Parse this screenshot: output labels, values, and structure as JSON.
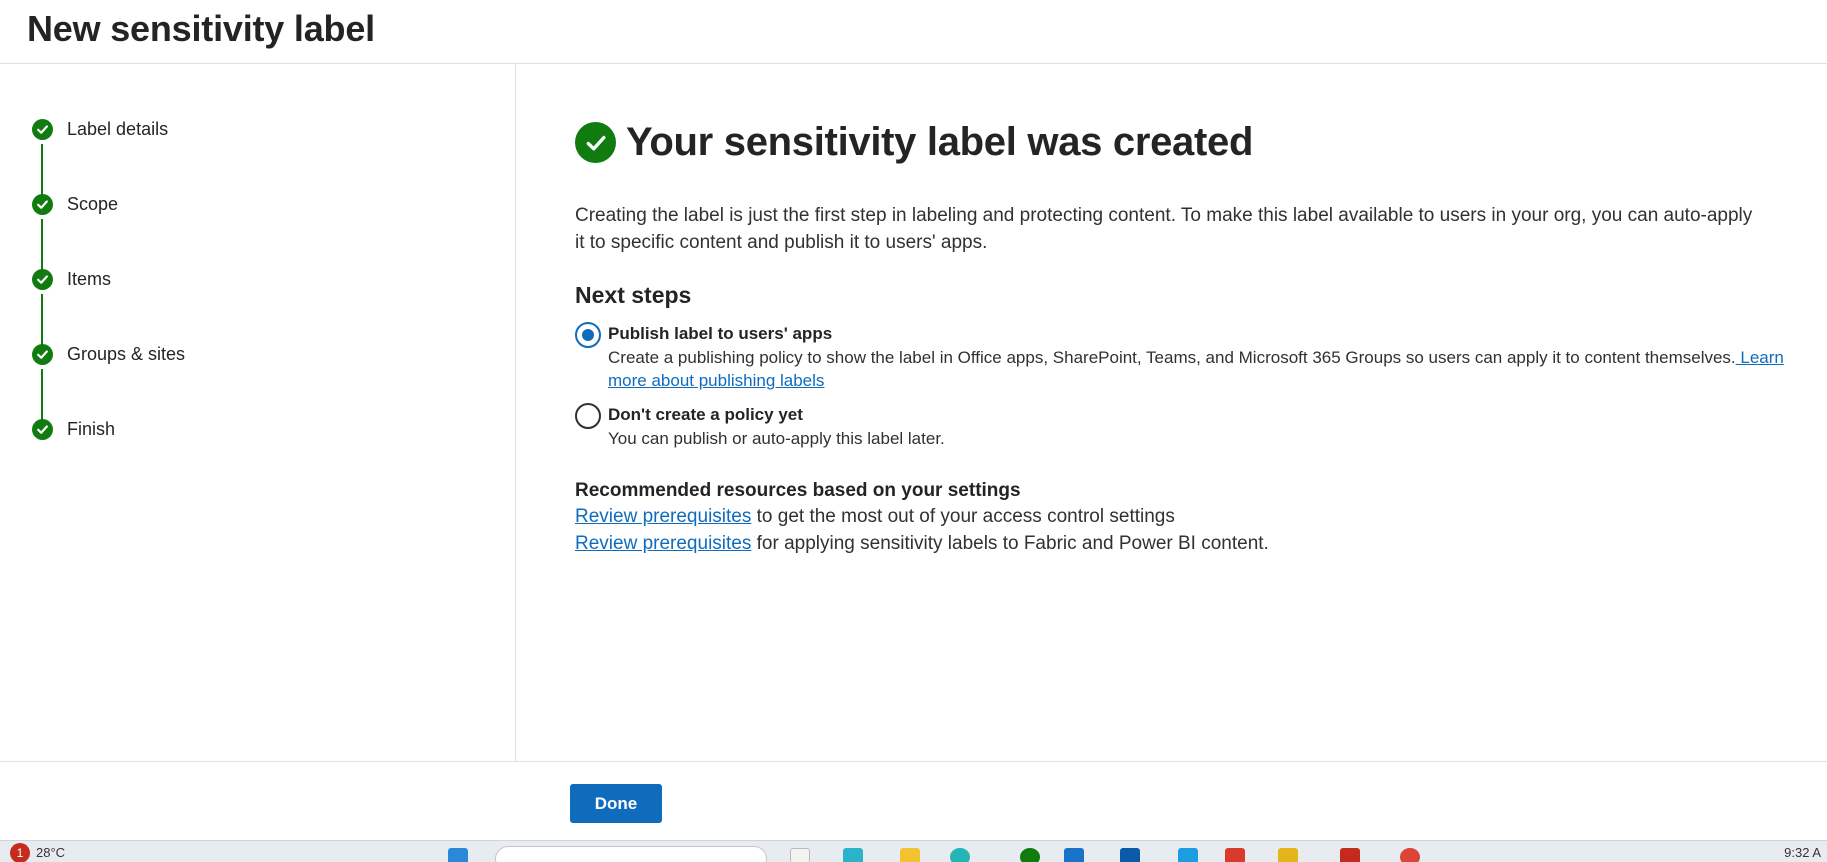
{
  "header": {
    "title": "New sensitivity label"
  },
  "sidebar": {
    "steps": [
      {
        "label": "Label details",
        "status": "complete"
      },
      {
        "label": "Scope",
        "status": "complete"
      },
      {
        "label": "Items",
        "status": "complete"
      },
      {
        "label": "Groups & sites",
        "status": "complete"
      },
      {
        "label": "Finish",
        "status": "complete"
      }
    ]
  },
  "main": {
    "success_title": "Your sensitivity label was created",
    "intro_line1": "Creating the label is just the first step in labeling and protecting content. To make this label available to users in your org, you can auto-apply",
    "intro_line2": "it to specific content and publish it to users' apps.",
    "next_steps_heading": "Next steps",
    "options": [
      {
        "title": "Publish label to users' apps",
        "description": "Create a publishing policy to show the label in Office apps, SharePoint, Teams, and Microsoft 365 Groups so users can apply it to content themselves.",
        "link_part1": " Learn",
        "link_part2": "more about publishing labels",
        "selected": true
      },
      {
        "title": "Don't create a policy yet",
        "description": "You can publish or auto-apply this label later.",
        "selected": false
      }
    ],
    "resources_heading": "Recommended resources based on your settings",
    "resources": [
      {
        "link": "Review prerequisites",
        "text": " to get the most out of your access control settings"
      },
      {
        "link": "Review prerequisites",
        "text": " for applying sensitivity labels to Fabric and Power BI content."
      }
    ]
  },
  "footer": {
    "done_label": "Done"
  },
  "taskbar": {
    "notification_count": "1",
    "temperature": "28°C",
    "time": "9:32 A"
  },
  "colors": {
    "accent": "#0f6cbd",
    "success": "#107c10",
    "divider": "#e1e1e1"
  },
  "icons": {
    "step": "check-circle-icon",
    "success": "check-circle-icon"
  }
}
